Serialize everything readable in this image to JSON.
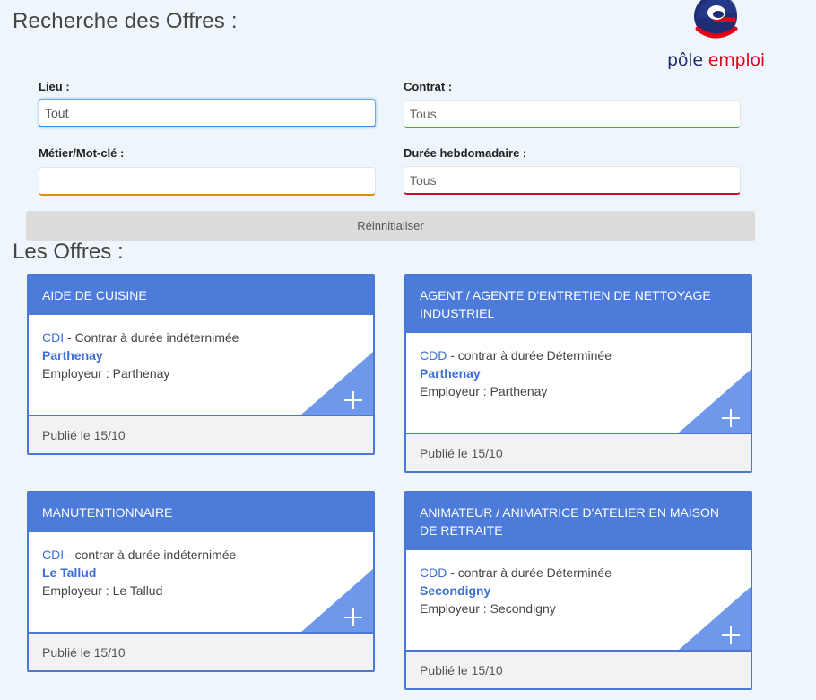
{
  "header": {
    "title": "Recherche des Offres :",
    "logo": {
      "word1": "pôle",
      "word2": "emploi",
      "mark_letter": "e",
      "brand_blue": "#1c2a6e",
      "brand_red": "#e2001a"
    }
  },
  "filters": {
    "lieu": {
      "label": "Lieu :",
      "value": "Tout"
    },
    "contrat": {
      "label": "Contrat :",
      "value": "Tous"
    },
    "metier": {
      "label": "Métier/Mot-clé :",
      "value": ""
    },
    "duree": {
      "label": "Durée hebdomadaire :",
      "value": "Tous"
    },
    "reset_label": "Réinnitialiser"
  },
  "offers_section": {
    "title": "Les Offres :"
  },
  "offers": [
    {
      "title": "AIDE DE CUISINE",
      "contract_type": "CDI",
      "contract_desc": " - Contrar à durée indéternimée",
      "city": "Parthenay",
      "employer": "Employeur : Parthenay",
      "published": "Publié le 15/10"
    },
    {
      "title": "AGENT / AGENTE D'ENTRETIEN DE NETTOYAGE INDUSTRIEL",
      "contract_type": "CDD",
      "contract_desc": " - contrar à durée Déterminée",
      "city": "Parthenay",
      "employer": "Employeur : Parthenay",
      "published": "Publié le 15/10"
    },
    {
      "title": "MANUTENTIONNAIRE",
      "contract_type": "CDI",
      "contract_desc": " - contrar à durée indéternimée",
      "city": "Le Tallud",
      "employer": "Employeur : Le Tallud",
      "published": "Publié le 15/10"
    },
    {
      "title": "ANIMATEUR / ANIMATRICE D'ATELIER EN MAISON DE RETRAITE",
      "contract_type": "CDD",
      "contract_desc": " - contrar à durée Déterminée",
      "city": "Secondigny",
      "employer": "Employeur : Secondigny",
      "published": "Publié le 15/10"
    }
  ],
  "colors": {
    "accent": "#4d7bd9",
    "corner": "#6f97ea",
    "lieu_border": "#3a8ee6",
    "contrat_border": "#2db52d",
    "metier_border": "#e08a1e",
    "duree_border": "#c8102e"
  },
  "icons": {
    "expand": "plus-icon"
  }
}
